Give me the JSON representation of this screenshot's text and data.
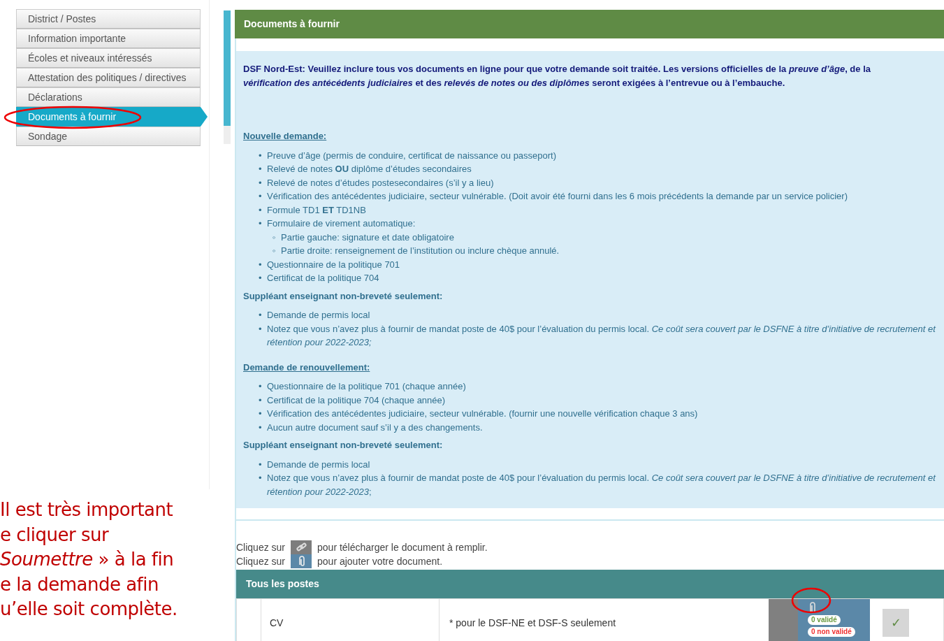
{
  "sidebar": {
    "items": [
      {
        "label": "District / Postes",
        "selected": false
      },
      {
        "label": "Information importante",
        "selected": false
      },
      {
        "label": "Écoles et niveaux intéressés",
        "selected": false
      },
      {
        "label": "Attestation des politiques / directives",
        "selected": false
      },
      {
        "label": "Déclarations",
        "selected": false
      },
      {
        "label": "Documents à fournir",
        "selected": true
      },
      {
        "label": "Sondage",
        "selected": false
      }
    ]
  },
  "note": {
    "lines": [
      "Il est très important",
      "e cliquer sur",
      "*Soumettre* » à la fin",
      "e la demande afin",
      "u’elle soit complète."
    ]
  },
  "panel": {
    "title": "Documents à fournir",
    "intro": "DSF Nord-Est: Veuillez inclure tous vos documents en ligne pour que votre demande soit traitée. Les versions officielles de la *preuve d’âge*, de la *vérification des antécédents judiciaires* et des *relevés de notes ou des diplômes* seront exigées à l’entrevue ou à l’embauche.",
    "sections": [
      {
        "kind": "heading",
        "title": "Nouvelle demande:",
        "marker": "•",
        "child_marker": "◦",
        "items": [
          {
            "text": "Preuve d’âge (permis de conduire, certificat de naissance ou passeport)"
          },
          {
            "text": "Relevé de notes **OU** diplôme d’études secondaires"
          },
          {
            "text": "Relevé de notes d’études postesecondaires (s’il y a lieu)"
          },
          {
            "text": "Vérification des antécédentes judiciaire, secteur vulnérable. (Doit avoir été fourni dans les 6 mois précédents la demande par un service policier)"
          },
          {
            "text": "Formule TD1 **ET** TD1NB"
          },
          {
            "text": "Formulaire de virement automatique:",
            "children": [
              {
                "text": "Partie gauche: signature et date obligatoire"
              },
              {
                "text": "Partie droite: renseignement de l’institution ou inclure chèque annulé."
              }
            ]
          },
          {
            "text": "Questionnaire de la politique 701"
          },
          {
            "text": "Certificat de la politique 704"
          }
        ]
      },
      {
        "kind": "subheading",
        "title": "Suppléant enseignant non-breveté seulement:",
        "marker": "•",
        "items": [
          {
            "text": "Demande de permis local"
          },
          {
            "text": "Notez que vous n’avez plus à fournir de mandat poste de 40$ pour l’évaluation du permis local. *Ce coût sera couvert par le DSFNE à titre d’initiative de recrutement et rétention pour 2022-2023;*"
          }
        ]
      },
      {
        "kind": "heading",
        "title": "Demande de renouvellement:",
        "marker": "•",
        "items": [
          {
            "text": "Questionnaire de la politique 701 (chaque année)"
          },
          {
            "text": "Certificat de la politique 704 (chaque année)"
          },
          {
            "text": "Vérification des antécédentes judiciaire, secteur vulnérable. (fournir une nouvelle vérification chaque 3 ans)"
          },
          {
            "text": "Aucun autre document sauf s’il y a des changements."
          }
        ]
      },
      {
        "kind": "subheading",
        "title": "Suppléant enseignant non-breveté seulement:",
        "marker": "•",
        "items": [
          {
            "text": "Demande de permis local"
          },
          {
            "text": "Notez que vous n’avez plus à fournir de mandat poste de 40$ pour l’évaluation du permis local. *Ce coût sera couvert par le DSFNE à titre d’initiative de recrutement et rétention pour 2022-2023*;"
          }
        ]
      }
    ]
  },
  "legend": [
    {
      "kind": "link",
      "before": "Cliquez sur",
      "after": "pour télécharger le document à remplir."
    },
    {
      "kind": "attach",
      "before": "Cliquez sur",
      "after": "pour ajouter votre document."
    }
  ],
  "table": {
    "title": "Tous les postes",
    "rows": [
      {
        "name": "CV",
        "note": "* pour le DSF-NE et DSF-S seulement",
        "validated": "0 validé",
        "not_validated": "0 non validé",
        "check": "✓"
      }
    ]
  }
}
